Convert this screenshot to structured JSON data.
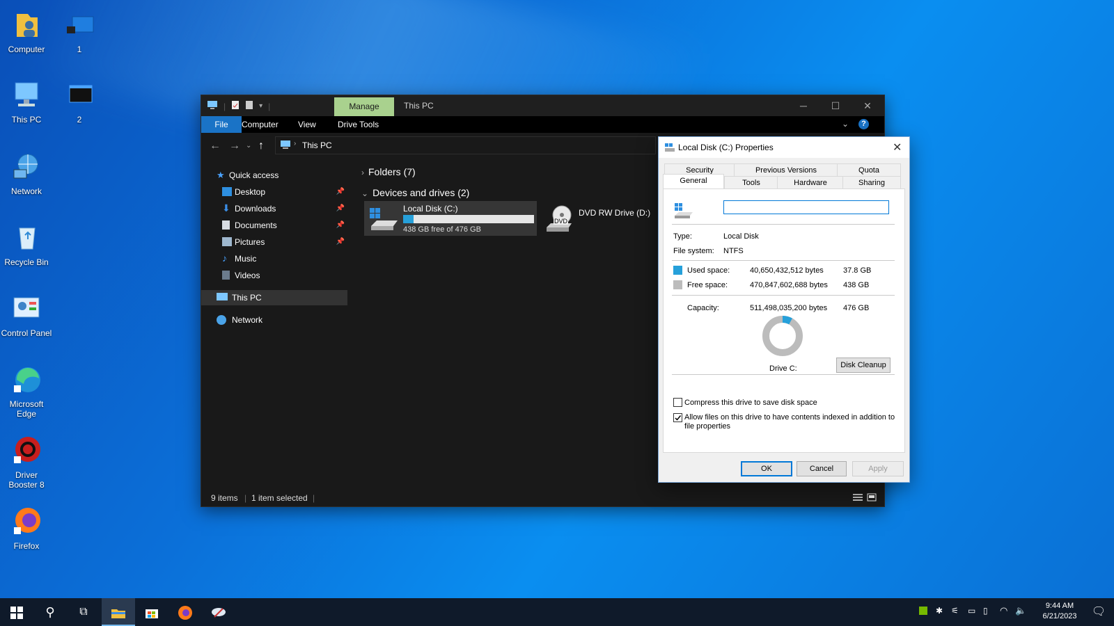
{
  "desktop": {
    "icons": [
      {
        "label": "Computer"
      },
      {
        "label": "1"
      },
      {
        "label": "This PC"
      },
      {
        "label": "2"
      },
      {
        "label": "Network"
      },
      {
        "label": "Recycle Bin"
      },
      {
        "label": "Control Panel"
      },
      {
        "label": "Microsoft Edge"
      },
      {
        "label": "Driver Booster 8"
      },
      {
        "label": "Firefox"
      }
    ]
  },
  "explorer": {
    "manage_tab": "Manage",
    "title": "This PC",
    "ribbon_tabs": [
      "File",
      "Computer",
      "View",
      "Drive Tools"
    ],
    "address": "This PC",
    "nav": {
      "quick_access": "Quick access",
      "items": [
        "Desktop",
        "Downloads",
        "Documents",
        "Pictures",
        "Music",
        "Videos"
      ],
      "this_pc": "This PC",
      "network": "Network"
    },
    "groups": {
      "folders": "Folders (7)",
      "devices": "Devices and drives (2)"
    },
    "drives": [
      {
        "name": "Local Disk (C:)",
        "free_text": "438 GB free of 476 GB",
        "used_fraction": 0.08
      },
      {
        "name": "DVD RW Drive (D:)",
        "badge": "DVD"
      }
    ],
    "status": {
      "items": "9 items",
      "selected": "1 item selected"
    }
  },
  "dialog": {
    "title": "Local Disk (C:) Properties",
    "tabs_row1": [
      "Security",
      "Previous Versions",
      "Quota"
    ],
    "tabs_row2": [
      "General",
      "Tools",
      "Hardware",
      "Sharing"
    ],
    "name_value": "",
    "type_label": "Type:",
    "type_value": "Local Disk",
    "fs_label": "File system:",
    "fs_value": "NTFS",
    "used": {
      "label": "Used space:",
      "bytes": "40,650,432,512 bytes",
      "size": "37.8 GB",
      "color": "#26a0da"
    },
    "free": {
      "label": "Free space:",
      "bytes": "470,847,602,688 bytes",
      "size": "438 GB",
      "color": "#bcbcbc"
    },
    "capacity": {
      "label": "Capacity:",
      "bytes": "511,498,035,200 bytes",
      "size": "476 GB"
    },
    "used_fraction": 0.08,
    "drive_label": "Drive C:",
    "cleanup_button": "Disk Cleanup",
    "compress_label": "Compress this drive to save disk space",
    "compress_checked": false,
    "index_label_line1": "Allow files on this drive to have contents indexed in addition to",
    "index_label_line2": "file properties",
    "index_checked": true,
    "buttons": {
      "ok": "OK",
      "cancel": "Cancel",
      "apply": "Apply"
    }
  },
  "taskbar": {
    "time": "9:44 AM",
    "date": "6/21/2023"
  }
}
